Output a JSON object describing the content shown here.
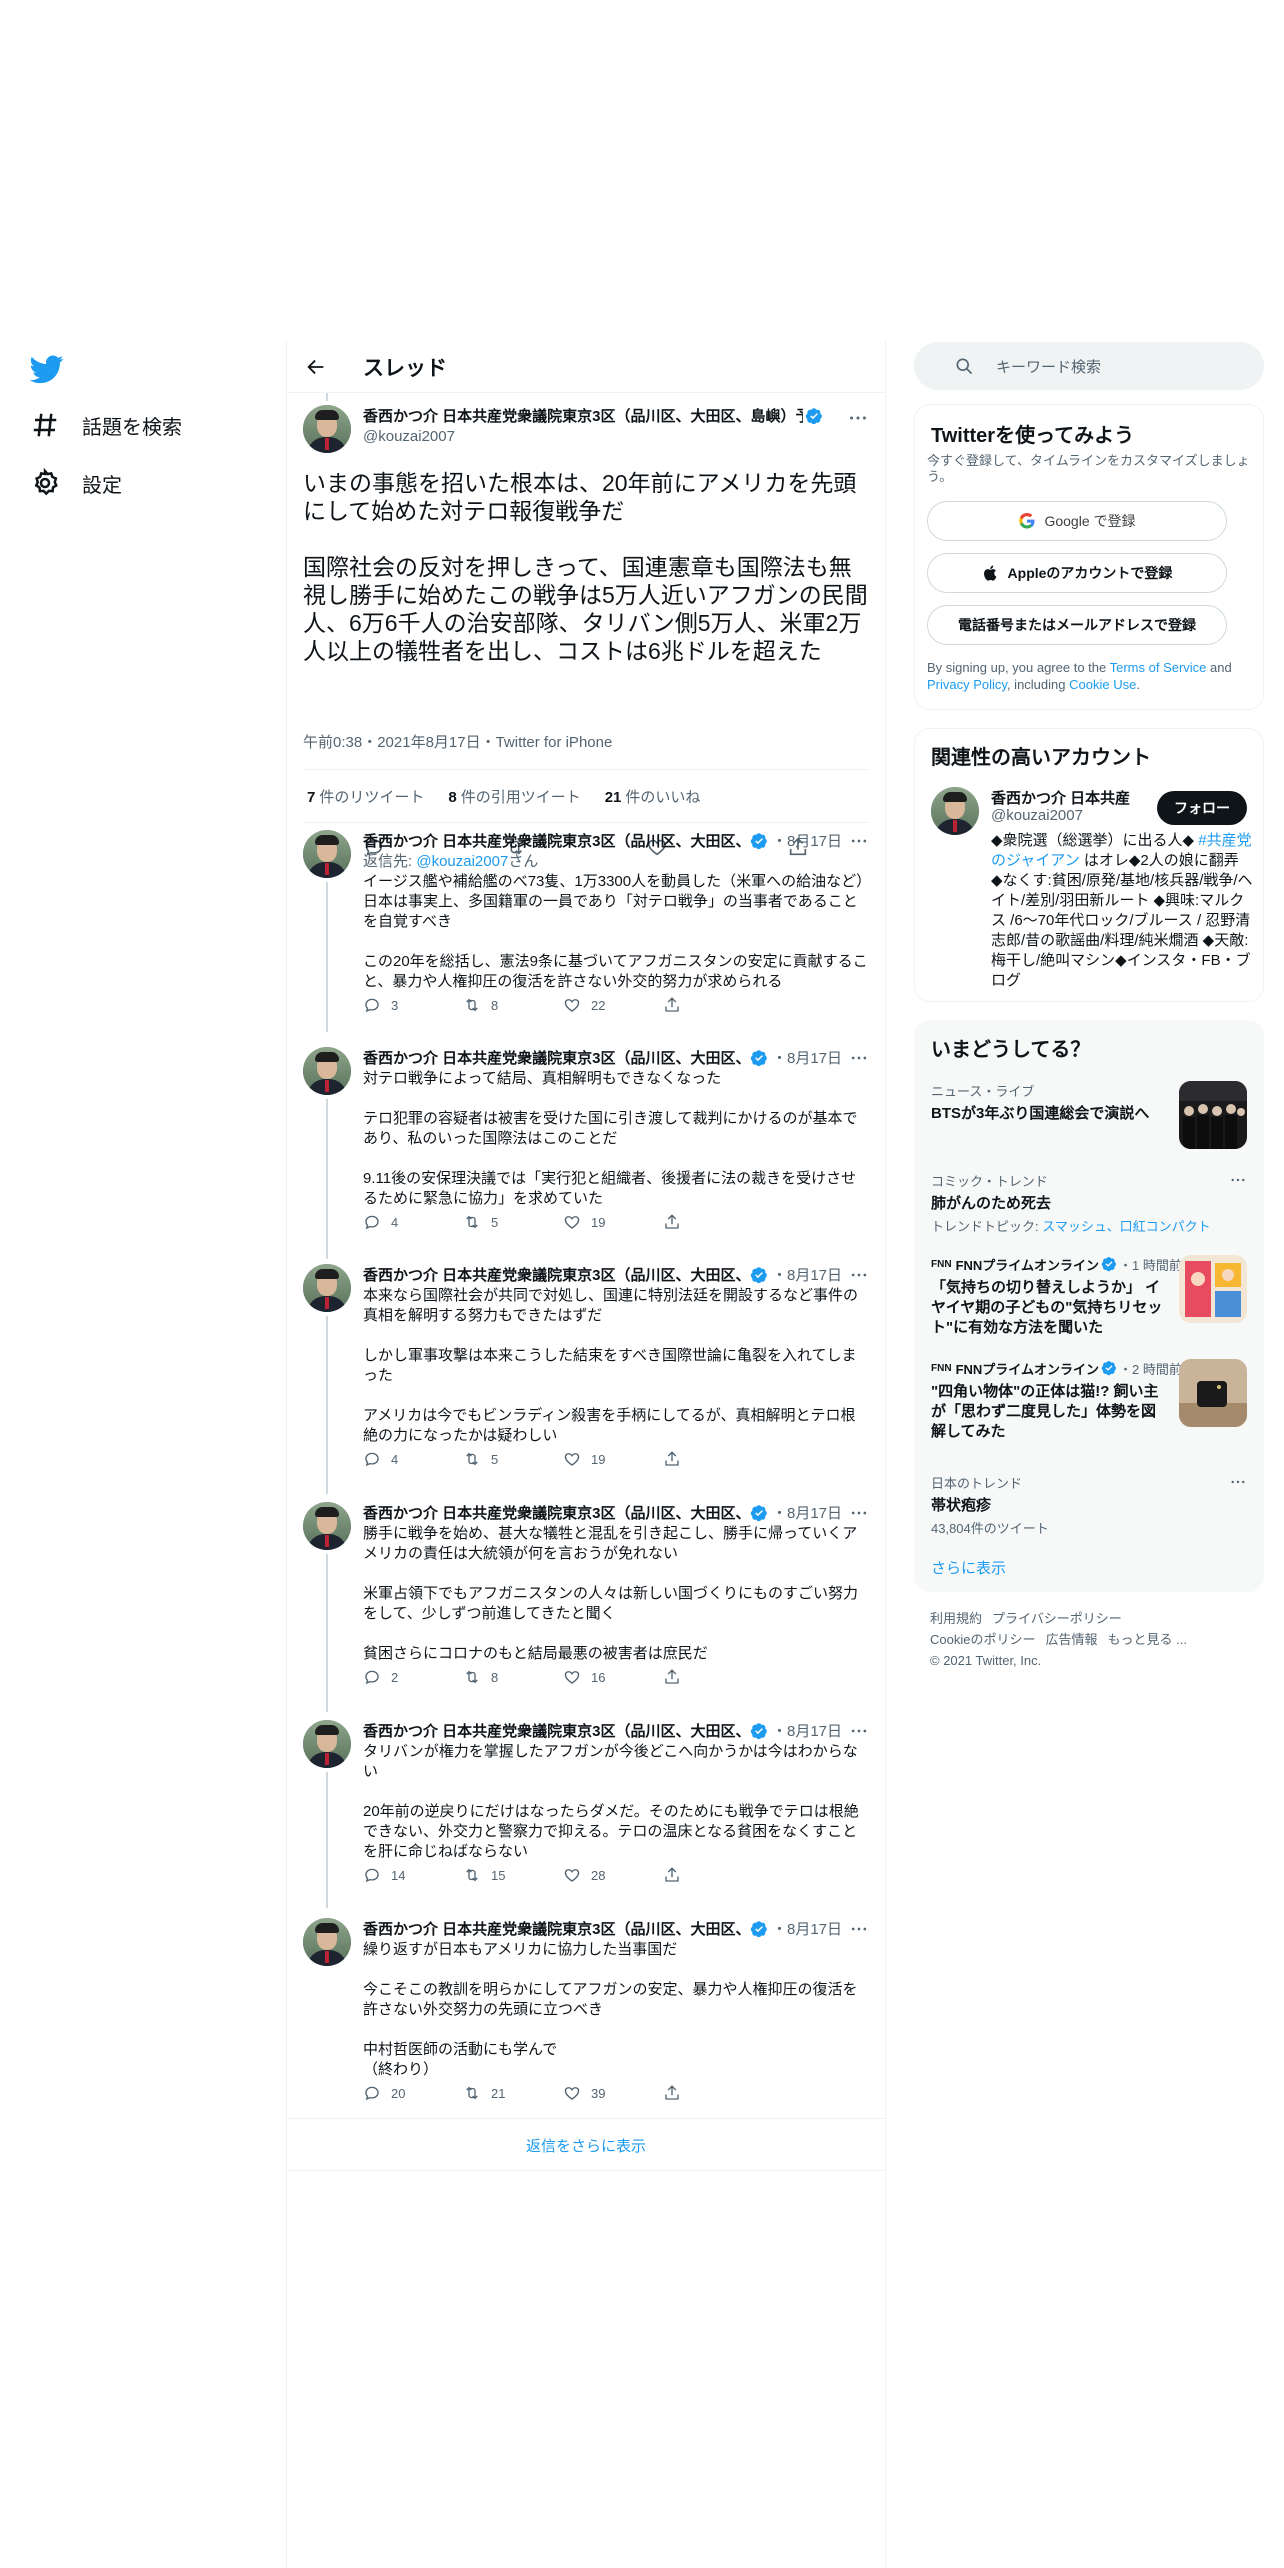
{
  "nav": {
    "explore_label": "話題を検索",
    "settings_label": "設定"
  },
  "header": {
    "title": "スレッド"
  },
  "main_tweet": {
    "name": "香西かつ介 日本共産党衆議院東京3区（品川区、大田区、島嶼）予",
    "handle": "@kouzai2007",
    "text": "いまの事態を招いた根本は、20年前にアメリカを先頭にして始めた対テロ報復戦争だ\n\n国際社会の反対を押しきって、国連憲章も国際法も無視し勝手に始めたこの戦争は5万人近いアフガンの民間人、6万6千人の治安部隊、タリバン側5万人、米軍2万人以上の犠牲者を出し、コストは6兆ドルを超えた",
    "meta": "午前0:38・2021年8月17日・Twitter for iPhone",
    "retweets_count": "7",
    "retweets_label": "件のリツイート",
    "quotes_count": "8",
    "quotes_label": "件の引用ツイート",
    "likes_count": "21",
    "likes_label": "件のいいね"
  },
  "replies": [
    {
      "name": "香西かつ介 日本共産党衆議院東京3区（品川区、大田区、",
      "date": "・8月17日",
      "reply_to_prefix": "返信先: ",
      "reply_to_handle": "@kouzai2007",
      "reply_to_suffix": "さん",
      "text": "イージス艦や補給艦のべ73隻、1万3300人を動員した（米軍への給油など）日本は事実上、多国籍軍の一員であり「対テロ戦争」の当事者であることを自覚すべき\n\nこの20年を総括し、憲法9条に基づいてアフガニスタンの安定に貢献すること、暴力や人権抑圧の復活を許さない外交的努力が求められる",
      "replies": "3",
      "retweets": "8",
      "likes": "22"
    },
    {
      "name": "香西かつ介 日本共産党衆議院東京3区（品川区、大田区、",
      "date": "・8月17日",
      "text": "対テロ戦争によって結局、真相解明もできなくなった\n\nテロ犯罪の容疑者は被害を受けた国に引き渡して裁判にかけるのが基本であり、私のいった国際法はこのことだ\n\n9.11後の安保理決議では「実行犯と組織者、後援者に法の裁きを受けさせるために緊急に協力」を求めていた",
      "replies": "4",
      "retweets": "5",
      "likes": "19"
    },
    {
      "name": "香西かつ介 日本共産党衆議院東京3区（品川区、大田区、",
      "date": "・8月17日",
      "text": "本来なら国際社会が共同で対処し、国連に特別法廷を開設するなど事件の真相を解明する努力もできたはずだ\n\nしかし軍事攻撃は本来こうした結束をすべき国際世論に亀裂を入れてしまった\n\nアメリカは今でもビンラディン殺害を手柄にしてるが、真相解明とテロ根絶の力になったかは疑わしい",
      "replies": "4",
      "retweets": "5",
      "likes": "19"
    },
    {
      "name": "香西かつ介 日本共産党衆議院東京3区（品川区、大田区、",
      "date": "・8月17日",
      "text": "勝手に戦争を始め、甚大な犠牲と混乱を引き起こし、勝手に帰っていくアメリカの責任は大統領が何を言おうが免れない\n\n米軍占領下でもアフガニスタンの人々は新しい国づくりにものすごい努力をして、少しずつ前進してきたと聞く\n\n貧困さらにコロナのもと結局最悪の被害者は庶民だ",
      "replies": "2",
      "retweets": "8",
      "likes": "16"
    },
    {
      "name": "香西かつ介 日本共産党衆議院東京3区（品川区、大田区、",
      "date": "・8月17日",
      "text": "タリバンが権力を掌握したアフガンが今後どこへ向かうかは今はわからない\n\n20年前の逆戻りにだけはなったらダメだ。そのためにも戦争でテロは根絶できない、外交力と警察力で抑える。テロの温床となる貧困をなくすことを肝に命じねばならない",
      "replies": "14",
      "retweets": "15",
      "likes": "28"
    },
    {
      "name": "香西かつ介 日本共産党衆議院東京3区（品川区、大田区、",
      "date": "・8月17日",
      "text": "繰り返すが日本もアメリカに協力した当事国だ\n\n今こそこの教訓を明らかにしてアフガンの安定、暴力や人権抑圧の復活を許さない外交努力の先頭に立つべき\n\n中村哲医師の活動にも学んで\n（終わり）",
      "replies": "20",
      "retweets": "21",
      "likes": "39"
    }
  ],
  "show_more_replies": "返信をさらに表示",
  "search": {
    "placeholder": "キーワード検索"
  },
  "signup": {
    "title": "Twitterを使ってみよう",
    "subtitle": "今すぐ登録して、タイムラインをカスタマイズしましょう。",
    "google_label": "Google で登録",
    "apple_label": "Appleのアカウントで登録",
    "phone_label": "電話番号またはメールアドレスで登録",
    "legal_prefix": "By signing up, you agree to the ",
    "terms": "Terms of Service",
    "legal_and": " and ",
    "privacy": "Privacy Policy",
    "legal_including": ", including ",
    "cookie": "Cookie Use",
    "legal_end": "."
  },
  "related": {
    "title": "関連性の高いアカウント",
    "name": "香西かつ介 日本共産",
    "handle": "@kouzai2007",
    "follow_label": "フォロー",
    "bio_prefix": "◆衆院選（総選挙）に出る人◆ ",
    "bio_tag": "#共産党のジャイアン",
    "bio_rest": " はオレ◆2人の娘に翻弄 ◆なくす:貧困/原発/基地/核兵器/戦争/ヘイト/差別/羽田新ルート ◆興味:マルクス /6～70年代ロック/ブルース / 忍野清志郎/昔の歌謡曲/料理/純米燗酒 ◆天敵:梅干し/絶叫マシン◆インスタ・FB・ブログ"
  },
  "trends": {
    "title": "いまどうしてる？",
    "items": [
      {
        "context": "ニュース・ライブ",
        "title": "BTSが3年ぶり国連総会で演説へ"
      },
      {
        "context": "コミック・トレンド",
        "title": "肺がんのため死去",
        "sub_prefix": "トレンドトピック: ",
        "sub_links": "スマッシュ、口紅コンパクト"
      },
      {
        "source": "FNNプライムオンライン",
        "time": "・1 時間前",
        "title": "「気持ちの切り替えしようか」 イヤイヤ期の子どもの\"気持ちリセット\"に有効な方法を聞いた"
      },
      {
        "source": "FNNプライムオンライン",
        "time": "・2 時間前",
        "title": "\"四角い物体\"の正体は猫!? 飼い主が「思わず二度見した」体勢を図解してみた"
      },
      {
        "context": "日本のトレンド",
        "title": "帯状疱疹",
        "sub": "43,804件のツイート"
      }
    ],
    "show_more": "さらに表示"
  },
  "footer": {
    "terms": "利用規約",
    "privacy": "プライバシーポリシー",
    "cookie": "Cookieのポリシー",
    "ads": "広告情報",
    "more": "もっと見る ...",
    "copyright": "© 2021 Twitter, Inc."
  },
  "colors": {
    "accent": "#1d9bf0",
    "text": "#0f1419",
    "secondary": "#536471",
    "border": "#eff3f4"
  }
}
